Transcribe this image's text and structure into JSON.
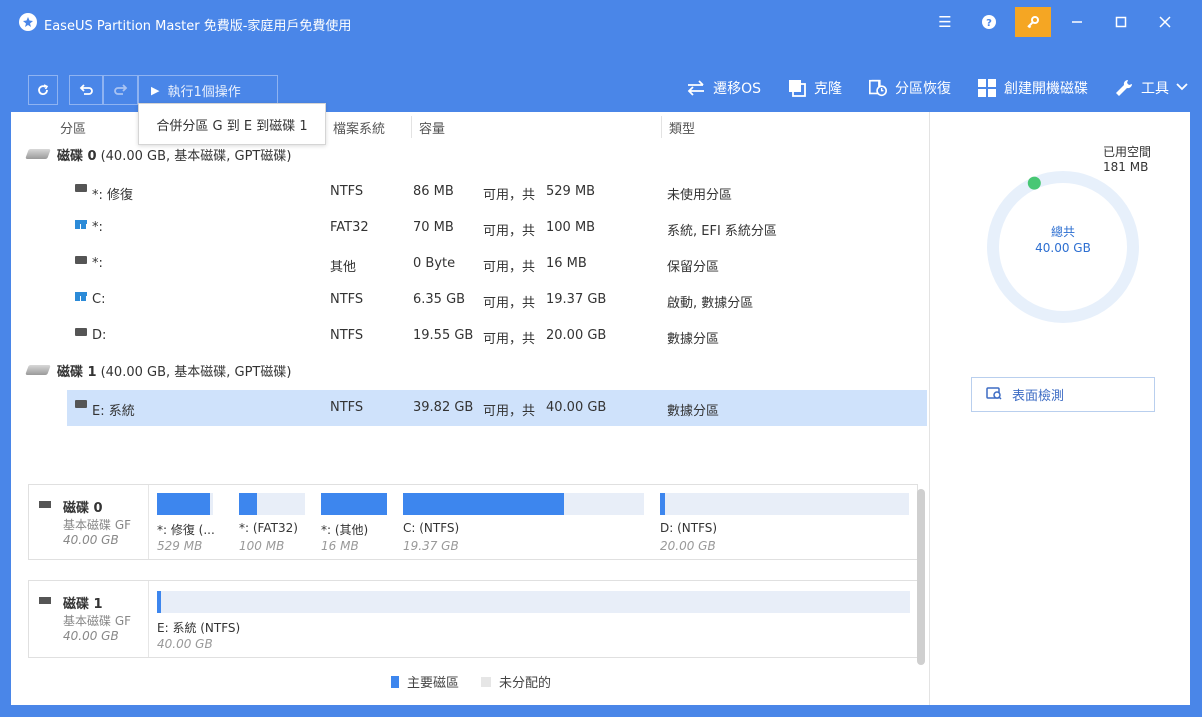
{
  "window": {
    "title": "EaseUS Partition Master 免費版-家庭用戶免費使用"
  },
  "toolbar": {
    "execute_label": "執行1個操作",
    "tools": [
      {
        "label": "遷移OS",
        "icon": "migrate-icon"
      },
      {
        "label": "克隆",
        "icon": "clone-icon"
      },
      {
        "label": "分區恢復",
        "icon": "recovery-icon"
      },
      {
        "label": "創建開機磁碟",
        "icon": "windows-icon"
      },
      {
        "label": "工具",
        "icon": "wrench-icon"
      }
    ]
  },
  "tooltip": "合併分區 G 到 E 到磁碟 1",
  "table": {
    "headers": {
      "partition": "分區",
      "filesystem": "檔案系統",
      "capacity": "容量",
      "type": "類型"
    },
    "disks": [
      {
        "name": "磁碟 0",
        "info": "(40.00 GB, 基本磁碟, GPT磁碟)",
        "partitions": [
          {
            "name": "*: 修復",
            "fs": "NTFS",
            "used": "86 MB",
            "free_label": "可用，共",
            "total": "529 MB",
            "type": "未使用分區",
            "icon": "drive"
          },
          {
            "name": "*:",
            "fs": "FAT32",
            "used": "70 MB",
            "free_label": "可用，共",
            "total": "100 MB",
            "type": "系統, EFI 系統分區",
            "icon": "win"
          },
          {
            "name": "*:",
            "fs": "其他",
            "used": "0 Byte",
            "free_label": "可用，共",
            "total": "16 MB",
            "type": "保留分區",
            "icon": "drive"
          },
          {
            "name": "C:",
            "fs": "NTFS",
            "used": "6.35 GB",
            "free_label": "可用，共",
            "total": "19.37 GB",
            "type": "啟動, 數據分區",
            "icon": "win"
          },
          {
            "name": "D:",
            "fs": "NTFS",
            "used": "19.55 GB",
            "free_label": "可用，共",
            "total": "20.00 GB",
            "type": "數據分區",
            "icon": "drive"
          }
        ]
      },
      {
        "name": "磁碟 1",
        "info": "(40.00 GB, 基本磁碟, GPT磁碟)",
        "partitions": [
          {
            "name": "E: 系統",
            "fs": "NTFS",
            "used": "39.82 GB",
            "free_label": "可用，共",
            "total": "40.00 GB",
            "type": "數據分區",
            "icon": "drive",
            "selected": true
          }
        ]
      }
    ]
  },
  "diskmap": [
    {
      "name": "磁碟 0",
      "type": "基本磁碟  GF",
      "size": "40.00 GB",
      "segments": [
        {
          "label": "*: 修復 (...",
          "size": "529 MB",
          "fill_fraction": 0.95
        },
        {
          "label": "*:  (FAT32)",
          "size": "100 MB",
          "fill_fraction": 0.28
        },
        {
          "label": "*:  (其他)",
          "size": "16 MB",
          "fill_fraction": 1.0
        },
        {
          "label": "C:  (NTFS)",
          "size": "19.37 GB",
          "fill_fraction": 0.67
        },
        {
          "label": "D:  (NTFS)",
          "size": "20.00 GB",
          "fill_fraction": 0.02
        }
      ]
    },
    {
      "name": "磁碟 1",
      "type": "基本磁碟  GF",
      "size": "40.00 GB",
      "segments": [
        {
          "label": "E: 系統 (NTFS)",
          "size": "40.00 GB",
          "fill_fraction": 0.005
        }
      ]
    }
  ],
  "legend": {
    "primary": "主要磁區",
    "unallocated": "未分配的"
  },
  "side": {
    "used_label": "已用空間",
    "used_value": "181 MB",
    "used_fraction": 0.0045,
    "total_label": "總共",
    "total_value": "40.00 GB",
    "surface_test": "表面檢測"
  },
  "colors": {
    "accent": "#4a86e8",
    "primary_partition": "#3d86ee",
    "selected_row": "#cfe2fb",
    "used_dot": "#48c774",
    "key_button": "#f5a623"
  }
}
